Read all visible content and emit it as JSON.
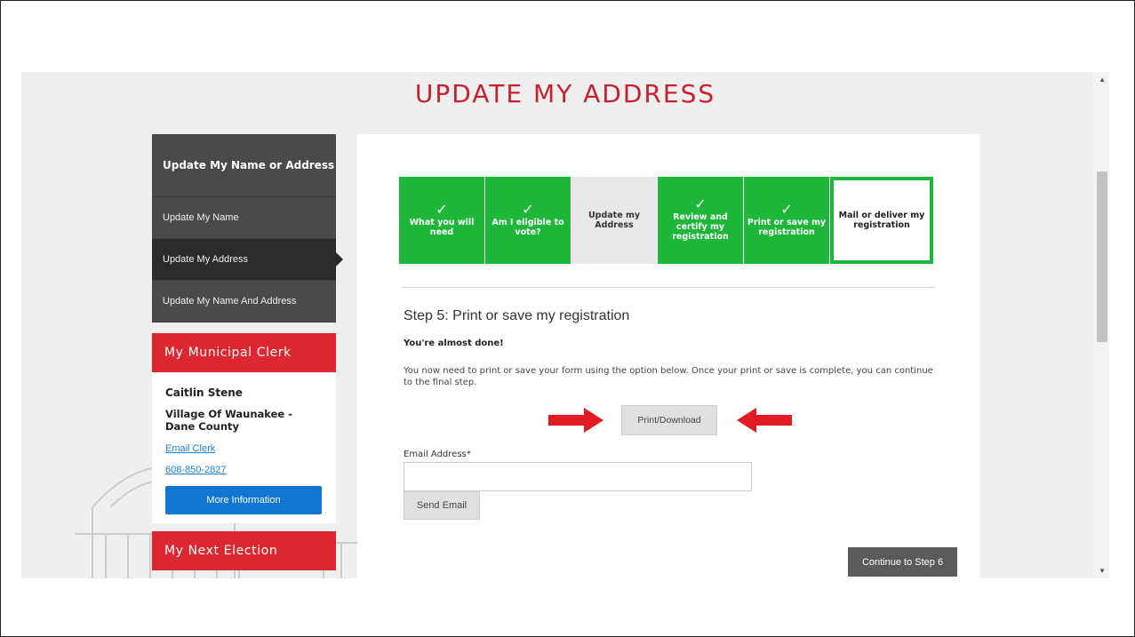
{
  "page": {
    "title": "UPDATE MY ADDRESS"
  },
  "sidebar": {
    "heading": "Update My Name or Address",
    "items": [
      {
        "label": "Update My Name"
      },
      {
        "label": "Update My Address"
      },
      {
        "label": "Update My Name And Address"
      }
    ],
    "active_item": "Update My Address"
  },
  "clerk": {
    "heading": "My Municipal Clerk",
    "name": "Caitlin Stene",
    "municipality": "Village Of Waunakee - Dane County",
    "email_link": "Email Clerk",
    "phone": "608-850-2827",
    "more_button": "More Information"
  },
  "next_election": {
    "heading": "My Next Election"
  },
  "steps": [
    {
      "label": "What you will need",
      "status": "done"
    },
    {
      "label": "Am I eligible to vote?",
      "status": "done"
    },
    {
      "label": "Update my Address",
      "status": "current"
    },
    {
      "label": "Review and certify my registration",
      "status": "done"
    },
    {
      "label": "Print or save my registration",
      "status": "done"
    },
    {
      "label": "Mail or deliver my registration",
      "status": "next"
    }
  ],
  "main": {
    "step_title": "Step 5: Print or save my registration",
    "almost_done": "You're almost done!",
    "instructions": "You now need to print or save your form using the option below. Once your print or save is complete, you can continue to the final step.",
    "print_button": "Print/Download",
    "email_label": "Email Address*",
    "email_value": "",
    "send_button": "Send Email",
    "continue_button": "Continue to Step 6"
  },
  "colors": {
    "accent_red": "#dd2730",
    "step_green": "#1eb73a",
    "link_blue": "#1a7fd0",
    "button_blue": "#0f76d1"
  },
  "icons": {
    "check": "check-icon",
    "arrow": "red-arrow-icon"
  }
}
